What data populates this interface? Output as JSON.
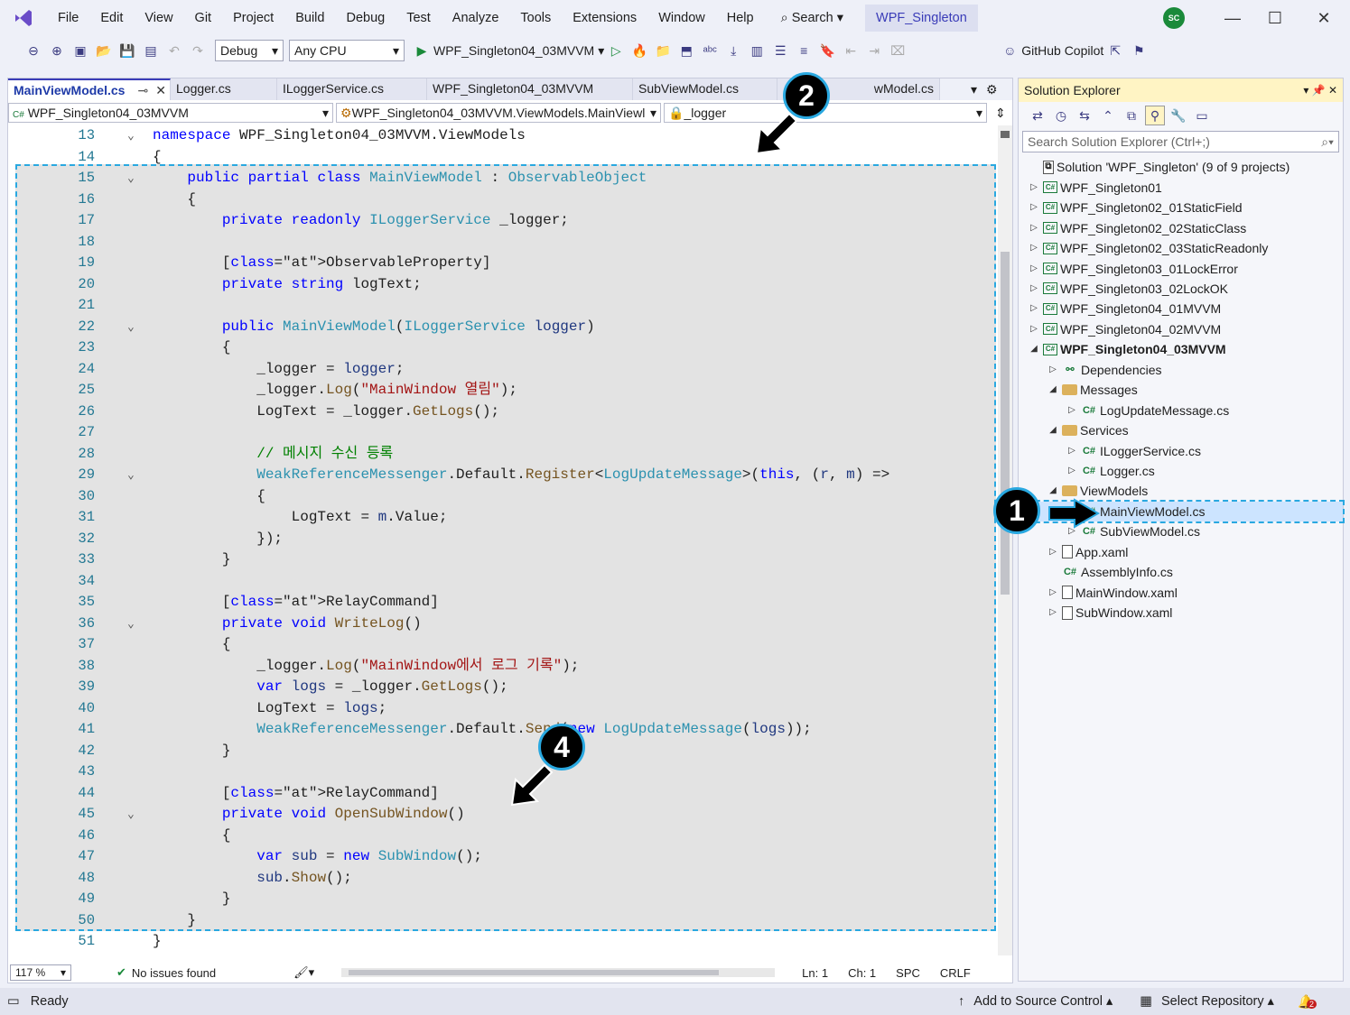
{
  "menu": [
    "File",
    "Edit",
    "View",
    "Git",
    "Project",
    "Build",
    "Debug",
    "Test",
    "Analyze",
    "Tools",
    "Extensions",
    "Window",
    "Help"
  ],
  "search_label": "Search",
  "solution_badge": "WPF_Singleton",
  "avatar_initials": "SC",
  "toolbar": {
    "config": "Debug",
    "platform": "Any CPU",
    "run_target": "WPF_Singleton04_03MVVM",
    "copilot": "GitHub Copilot"
  },
  "tabs": [
    "MainViewModel.cs",
    "Logger.cs",
    "ILoggerService.cs",
    "WPF_Singleton04_03MVVM",
    "SubViewModel.cs",
    "wModel.cs"
  ],
  "nav": {
    "project": "WPF_Singleton04_03MVVM",
    "type": "WPF_Singleton04_03MVVM.ViewModels.MainViewl",
    "member": "_logger"
  },
  "code_lines": [
    {
      "n": "13",
      "t": "namespace WPF_Singleton04_03MVVM.ViewModels"
    },
    {
      "n": "14",
      "t": "{"
    },
    {
      "n": "15",
      "t": "    public partial class MainViewModel : ObservableObject"
    },
    {
      "n": "16",
      "t": "    {"
    },
    {
      "n": "17",
      "t": "        private readonly ILoggerService _logger;"
    },
    {
      "n": "18",
      "t": ""
    },
    {
      "n": "19",
      "t": "        [ObservableProperty]"
    },
    {
      "n": "20",
      "t": "        private string logText;"
    },
    {
      "n": "21",
      "t": ""
    },
    {
      "n": "22",
      "t": "        public MainViewModel(ILoggerService logger)"
    },
    {
      "n": "23",
      "t": "        {"
    },
    {
      "n": "24",
      "t": "            _logger = logger;"
    },
    {
      "n": "25",
      "t": "            _logger.Log(\"MainWindow 열림\");"
    },
    {
      "n": "26",
      "t": "            LogText = _logger.GetLogs();"
    },
    {
      "n": "27",
      "t": ""
    },
    {
      "n": "28",
      "t": "            // 메시지 수신 등록"
    },
    {
      "n": "29",
      "t": "            WeakReferenceMessenger.Default.Register<LogUpdateMessage>(this, (r, m) =>"
    },
    {
      "n": "30",
      "t": "            {"
    },
    {
      "n": "31",
      "t": "                LogText = m.Value;"
    },
    {
      "n": "32",
      "t": "            });"
    },
    {
      "n": "33",
      "t": "        }"
    },
    {
      "n": "34",
      "t": ""
    },
    {
      "n": "35",
      "t": "        [RelayCommand]"
    },
    {
      "n": "36",
      "t": "        private void WriteLog()"
    },
    {
      "n": "37",
      "t": "        {"
    },
    {
      "n": "38",
      "t": "            _logger.Log(\"MainWindow에서 로그 기록\");"
    },
    {
      "n": "39",
      "t": "            var logs = _logger.GetLogs();"
    },
    {
      "n": "40",
      "t": "            LogText = logs;"
    },
    {
      "n": "41",
      "t": "            WeakReferenceMessenger.Default.Send(new LogUpdateMessage(logs));"
    },
    {
      "n": "42",
      "t": "        }"
    },
    {
      "n": "43",
      "t": ""
    },
    {
      "n": "44",
      "t": "        [RelayCommand]"
    },
    {
      "n": "45",
      "t": "        private void OpenSubWindow()"
    },
    {
      "n": "46",
      "t": "        {"
    },
    {
      "n": "47",
      "t": "            var sub = new SubWindow();"
    },
    {
      "n": "48",
      "t": "            sub.Show();"
    },
    {
      "n": "49",
      "t": "        }"
    },
    {
      "n": "50",
      "t": "    }"
    },
    {
      "n": "51",
      "t": "}"
    }
  ],
  "editor_status": {
    "zoom": "117 %",
    "issues": "No issues found",
    "ln": "Ln: 1",
    "ch": "Ch: 1",
    "spc": "SPC",
    "eol": "CRLF"
  },
  "solution_explorer": {
    "title": "Solution Explorer",
    "search_placeholder": "Search Solution Explorer (Ctrl+;)",
    "items": [
      {
        "label": "Solution 'WPF_Singleton' (9 of 9 projects)",
        "depth": 0,
        "arrow": "",
        "icon": "solution"
      },
      {
        "label": "WPF_Singleton01",
        "depth": 0,
        "arrow": "▷",
        "icon": "csproj"
      },
      {
        "label": "WPF_Singleton02_01StaticField",
        "depth": 0,
        "arrow": "▷",
        "icon": "csproj"
      },
      {
        "label": "WPF_Singleton02_02StaticClass",
        "depth": 0,
        "arrow": "▷",
        "icon": "csproj"
      },
      {
        "label": "WPF_Singleton02_03StaticReadonly",
        "depth": 0,
        "arrow": "▷",
        "icon": "csproj"
      },
      {
        "label": "WPF_Singleton03_01LockError",
        "depth": 0,
        "arrow": "▷",
        "icon": "csproj"
      },
      {
        "label": "WPF_Singleton03_02LockOK",
        "depth": 0,
        "arrow": "▷",
        "icon": "csproj"
      },
      {
        "label": "WPF_Singleton04_01MVVM",
        "depth": 0,
        "arrow": "▷",
        "icon": "csproj"
      },
      {
        "label": "WPF_Singleton04_02MVVM",
        "depth": 0,
        "arrow": "▷",
        "icon": "csproj"
      },
      {
        "label": "WPF_Singleton04_03MVVM",
        "depth": 0,
        "arrow": "◢",
        "icon": "csproj",
        "bold": true
      },
      {
        "label": "Dependencies",
        "depth": 1,
        "arrow": "▷",
        "icon": "deps"
      },
      {
        "label": "Messages",
        "depth": 1,
        "arrow": "◢",
        "icon": "folder"
      },
      {
        "label": "LogUpdateMessage.cs",
        "depth": 2,
        "arrow": "▷",
        "icon": "cs"
      },
      {
        "label": "Services",
        "depth": 1,
        "arrow": "◢",
        "icon": "folder"
      },
      {
        "label": "ILoggerService.cs",
        "depth": 2,
        "arrow": "▷",
        "icon": "cs"
      },
      {
        "label": "Logger.cs",
        "depth": 2,
        "arrow": "▷",
        "icon": "cs"
      },
      {
        "label": "ViewModels",
        "depth": 1,
        "arrow": "◢",
        "icon": "folder"
      },
      {
        "label": "MainViewModel.cs",
        "depth": 2,
        "arrow": "▷",
        "icon": "cs",
        "selected": true
      },
      {
        "label": "SubViewModel.cs",
        "depth": 2,
        "arrow": "▷",
        "icon": "cs"
      },
      {
        "label": "App.xaml",
        "depth": 1,
        "arrow": "▷",
        "icon": "xaml"
      },
      {
        "label": "AssemblyInfo.cs",
        "depth": 1,
        "arrow": "",
        "icon": "cs"
      },
      {
        "label": "MainWindow.xaml",
        "depth": 1,
        "arrow": "▷",
        "icon": "xaml"
      },
      {
        "label": "SubWindow.xaml",
        "depth": 1,
        "arrow": "▷",
        "icon": "xaml"
      }
    ]
  },
  "statusbar": {
    "ready": "Ready",
    "source_control": "Add to Source Control",
    "repo": "Select Repository",
    "notif_count": "2"
  },
  "badges": [
    "1",
    "2",
    "4"
  ],
  "colors": {
    "accent": "#29a8e0",
    "vs_purple": "#3a3cb8"
  }
}
